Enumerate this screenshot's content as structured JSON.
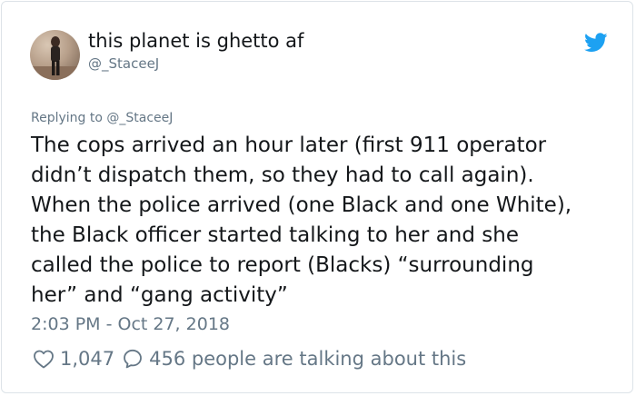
{
  "user": {
    "display_name": "this planet is ghetto af",
    "handle": "@_StaceeJ"
  },
  "tweet": {
    "replying_to": "Replying to @_StaceeJ",
    "text_lines": [
      "The cops arrived an hour later (first 911 operator",
      "didn’t dispatch them, so they had to call again).",
      "When the police arrived (one Black and one White),",
      "the Black officer started talking to her and she",
      "called the police to report (Blacks) “surrounding",
      "her” and “gang activity”"
    ],
    "timestamp": "2:03 PM - Oct 27, 2018"
  },
  "actions": {
    "likes": "1,047",
    "talking": "456 people are talking about this"
  },
  "colors": {
    "twitter_blue": "#1da1f2",
    "text_primary": "#14171a",
    "text_secondary": "#657786",
    "border": "#dde3e8"
  },
  "icons": {
    "brand": "twitter-bird-icon",
    "like": "heart-icon",
    "reply": "speech-bubble-icon"
  }
}
